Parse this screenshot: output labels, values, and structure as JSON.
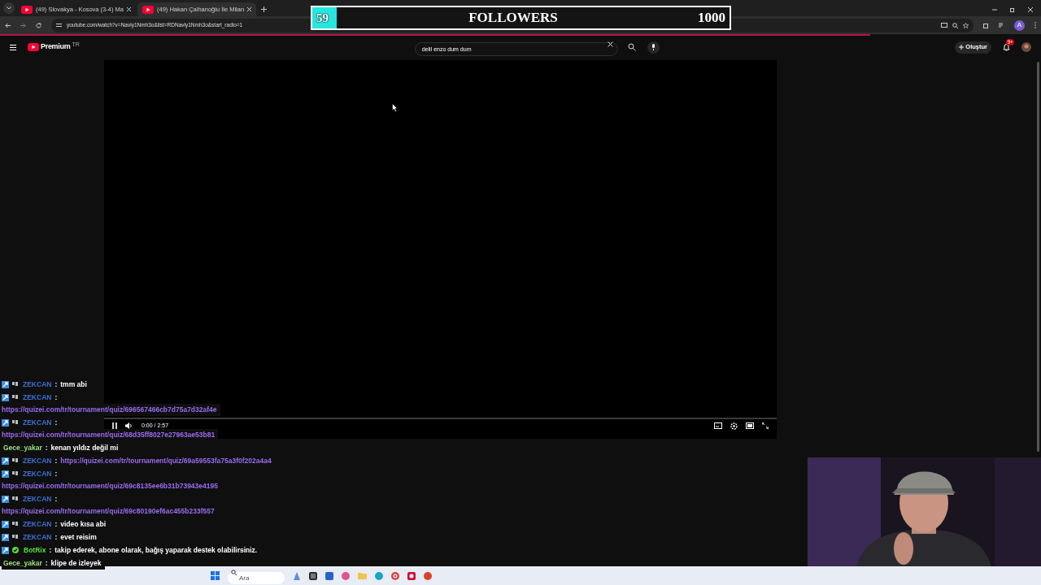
{
  "browser": {
    "tabs": [
      {
        "title": "(49) Slovakya - Kosova (3-4) Ma",
        "selected": false
      },
      {
        "title": "(49) Hakan Çalhanoğlu İle Milan",
        "selected": true
      }
    ],
    "address": "youtube.com/watch?v=Navly1Nmh3o&list=RDNavly1Nmh3o&start_radio=1",
    "avatar_letter": "A"
  },
  "followers": {
    "count": "59",
    "label": "FOLLOWERS",
    "goal": "1000",
    "level": 0.059
  },
  "youtube": {
    "logo": "Premium",
    "region": "TR",
    "search": {
      "value": "delil enzo dum dum"
    },
    "create": "Oluştur",
    "notifications": "9+"
  },
  "player": {
    "time": "0:00 / 2:57",
    "playing": true
  },
  "chat": [
    {
      "kind": "member",
      "user": "ZEKCAN",
      "color": "#3b6fd4",
      "separator": ":",
      "text": "tmm abi"
    },
    {
      "kind": "member",
      "user": "ZEKCAN",
      "color": "#3b6fd4",
      "separator": ":",
      "link": "https://quizei.com/tr/tournament/quiz/696567466cb7d75a7d32af4e",
      "link_on_new_line": true
    },
    {
      "kind": "member",
      "user": "ZEKCAN",
      "color": "#3b6fd4",
      "separator": ":",
      "link": "https://quizei.com/tr/tournament/quiz/68d35ff8027e27963ae53b81",
      "link_on_new_line": true
    },
    {
      "kind": "plain",
      "user": "Gece_yakar",
      "color": "#9be07a",
      "separator": ":",
      "text": "kenan yıldız değil mi"
    },
    {
      "kind": "member",
      "user": "ZEKCAN",
      "color": "#3b6fd4",
      "separator": ":",
      "link": "https://quizei.com/tr/tournament/quiz/69a59553fa75a3f0f202a4a4",
      "link_on_new_line": false
    },
    {
      "kind": "member",
      "user": "ZEKCAN",
      "color": "#3b6fd4",
      "separator": ":",
      "link": "https://quizei.com/tr/tournament/quiz/69c8135ee6b31b73943e4195",
      "link_on_new_line": true
    },
    {
      "kind": "member",
      "user": "ZEKCAN",
      "color": "#3b6fd4",
      "separator": ":",
      "link": "https://quizei.com/tr/tournament/quiz/69c80190ef6ac455b233f557",
      "link_on_new_line": true
    },
    {
      "kind": "member",
      "user": "ZEKCAN",
      "color": "#3b6fd4",
      "separator": ":",
      "text": "video kısa abi"
    },
    {
      "kind": "member",
      "user": "ZEKCAN",
      "color": "#3b6fd4",
      "separator": ":",
      "text": "evet reisim"
    },
    {
      "kind": "bot",
      "user": "BotRix",
      "color": "#53e03a",
      "separator": ":",
      "text": "takip ederek, abone olarak, bağış yaparak destek olabilirsiniz."
    },
    {
      "kind": "plain",
      "user": "Gece_yakar",
      "color": "#9be07a",
      "separator": ":",
      "text": "klipe de izleyek"
    }
  ],
  "taskbar": {
    "search": {
      "placeholder": "Ara"
    }
  }
}
